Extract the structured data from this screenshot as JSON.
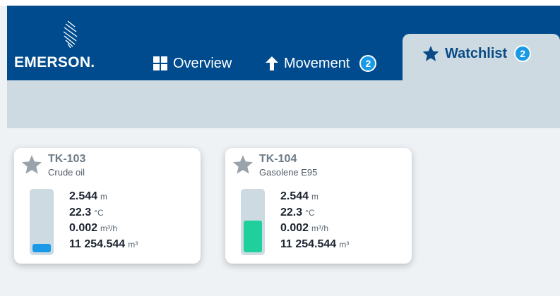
{
  "header": {
    "brand": "EMERSON.",
    "tabs": [
      {
        "label": "Overview",
        "icon": "grid-icon"
      },
      {
        "label": "Movement",
        "icon": "arrow-up-icon",
        "badge": "2"
      },
      {
        "label": "Watchlist",
        "icon": "star-icon",
        "badge": "2",
        "active": true
      }
    ]
  },
  "tanks": [
    {
      "name": "TK-103",
      "product": "Crude oil",
      "level": {
        "value": "2.544",
        "unit": "m"
      },
      "temperature": {
        "value": "22.3",
        "unit": "°C"
      },
      "flow": {
        "value": "0.002",
        "unit": "m³/h"
      },
      "volume": {
        "value": "11 254.544",
        "unit": "m³"
      },
      "fill_fraction": 0.14,
      "fill_color": "#1a9ae6"
    },
    {
      "name": "TK-104",
      "product": "Gasolene E95",
      "level": {
        "value": "2.544",
        "unit": "m"
      },
      "temperature": {
        "value": "22.3",
        "unit": "°C"
      },
      "flow": {
        "value": "0.002",
        "unit": "m³/h"
      },
      "volume": {
        "value": "11 254.544",
        "unit": "m³"
      },
      "fill_fraction": 0.52,
      "fill_color": "#1fcf9c"
    }
  ],
  "colors": {
    "header": "#004b8d",
    "band": "#cddae1",
    "badge": "#1a9ae6"
  }
}
